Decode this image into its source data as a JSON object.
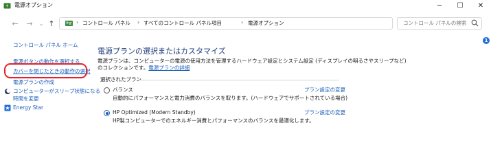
{
  "window": {
    "title": "電源オプション",
    "minimize": "─",
    "maximize": "☐",
    "close": "✕"
  },
  "nav": {
    "back": "←",
    "forward": "→",
    "history": "⌄",
    "up": "↑",
    "breadcrumb": [
      "コントロール パネル",
      "すべてのコントロール パネル項目",
      "電源オプション"
    ],
    "separator": "›",
    "dropdown": "⌄",
    "refresh": "↻",
    "search_placeholder": "コントロール パネルの検索"
  },
  "sidebar": {
    "home": "コントロール パネル ホーム",
    "items": [
      "電源ボタンの動作を選択する",
      "カバーを閉じたときの動作の選択",
      "電源プランの作成",
      "コンピューターがスリープ状態になる",
      "時間を変更"
    ],
    "energy_star": "Energy Star"
  },
  "main": {
    "title": "電源プランの選択またはカスタマイズ",
    "description_line1": "電源プランは、コンピューターの電源の使用方法を管理するハードウェア設定とシステム設定 (ディスプレイの明るさやスリープなど)",
    "description_line2": "のコレクションです。",
    "description_link": "電源プランの詳細",
    "section_label": "選択されたプラン",
    "plans": [
      {
        "name": "バランス",
        "description": "自動的にパフォーマンスと電力消費のバランスを取ります。(ハードウェアでサポートされている場合)",
        "change": "プラン設定の変更",
        "selected": false
      },
      {
        "name": "HP Optimized (Modern Standby)",
        "description": "HP製コンピューターでのエネルギー消費とパフォーマンスのバランスを最適化します。",
        "change": "プラン設定の変更",
        "selected": true
      }
    ]
  },
  "help_badge": "1",
  "colors": {
    "link": "#1a5cb8",
    "title": "#1e3c78",
    "highlight": "#e3222b",
    "badge": "#1e6fd6"
  }
}
